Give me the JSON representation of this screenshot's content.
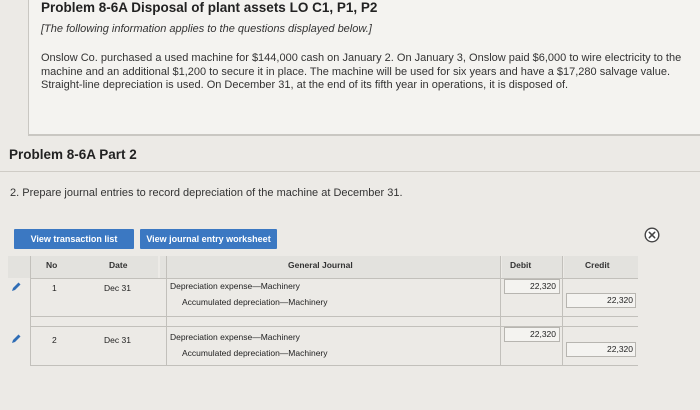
{
  "problem": {
    "title": "Problem 8-6A Disposal of plant assets LO C1, P1, P2",
    "note": "[The following information applies to the questions displayed below.]",
    "text": "Onslow Co. purchased a used machine for $144,000 cash on January 2. On January 3, Onslow paid $6,000 to wire electricity to the machine and an additional $1,200 to secure it in place. The machine will be used for six years and have a $17,280 salvage value. Straight-line depreciation is used. On December 31, at the end of its fifth year in operations, it is disposed of."
  },
  "part": {
    "title": "Problem 8-6A Part 2"
  },
  "question": "2. Prepare journal entries to record depreciation of the machine at December 31.",
  "buttons": {
    "view_transactions": "View transaction list",
    "view_worksheet": "View journal entry worksheet"
  },
  "journal": {
    "headers": {
      "no": "No",
      "date": "Date",
      "general_journal": "General Journal",
      "debit": "Debit",
      "credit": "Credit"
    },
    "entries": [
      {
        "no": "1",
        "date": "Dec 31",
        "debit_account": "Depreciation expense—Machinery",
        "credit_account": "Accumulated depreciation—Machinery",
        "debit": "22,320",
        "credit": "22,320"
      },
      {
        "no": "2",
        "date": "Dec 31",
        "debit_account": "Depreciation expense—Machinery",
        "credit_account": "Accumulated depreciation—Machinery",
        "debit": "22,320",
        "credit": "22,320"
      }
    ]
  },
  "colors": {
    "accent": "#3b78c2",
    "edit_icon": "#2f6db5"
  },
  "icons": {
    "edit": "pencil-icon",
    "close": "close-circle-icon"
  }
}
